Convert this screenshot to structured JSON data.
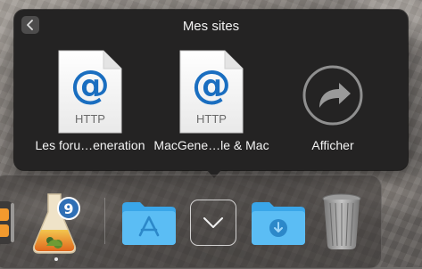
{
  "stack": {
    "title": "Mes sites",
    "back_icon": "chevron-left-icon",
    "items": [
      {
        "label": "Les foru…eneration",
        "icon": "http-location-file-icon",
        "glyph": "@",
        "type_text": "HTTP"
      },
      {
        "label": "MacGene…le & Mac",
        "icon": "http-location-file-icon",
        "glyph": "@",
        "type_text": "HTTP"
      },
      {
        "label": "Afficher",
        "icon": "open-in-finder-arrow-icon"
      }
    ]
  },
  "dock": {
    "apps": [
      {
        "name": "calculator-icon",
        "partial": true
      },
      {
        "name": "lab-flask-app-icon",
        "badge": "9",
        "running": true
      },
      {
        "name": "applications-folder-icon"
      },
      {
        "name": "stack-collapse-chevron-icon"
      },
      {
        "name": "downloads-folder-icon"
      },
      {
        "name": "trash-icon"
      }
    ]
  },
  "colors": {
    "popover_bg": "#242323",
    "folder_blue": "#4bb5f2",
    "text": "#f4f4f4"
  }
}
